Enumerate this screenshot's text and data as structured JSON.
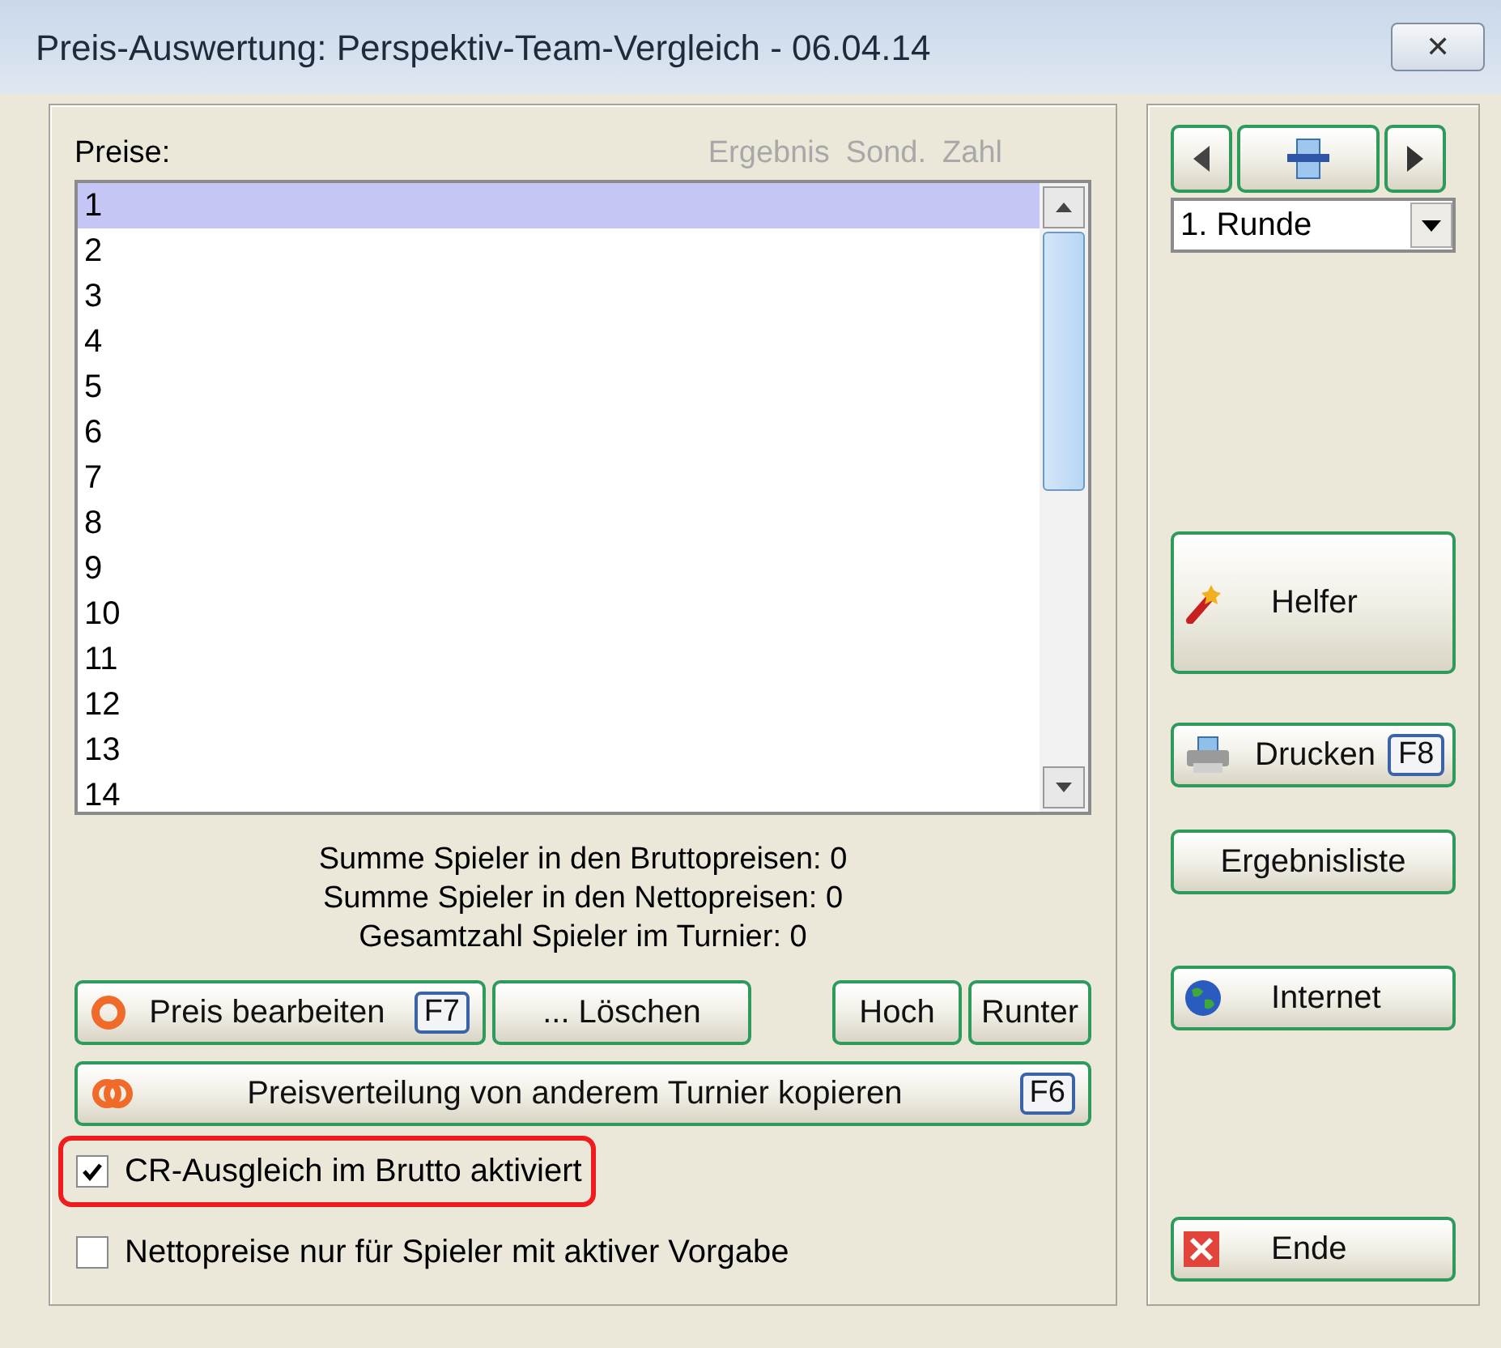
{
  "window": {
    "title": "Preis-Auswertung: Perspektiv-Team-Vergleich - 06.04.14",
    "close": "✕"
  },
  "prizes": {
    "label": "Preise:",
    "columns": [
      "Ergebnis",
      "Sond.",
      "Zahl"
    ],
    "rows": [
      {
        "label": "1",
        "selected": true
      },
      {
        "label": "2",
        "selected": false
      },
      {
        "label": "3",
        "selected": false
      },
      {
        "label": "4",
        "selected": false
      },
      {
        "label": "5",
        "selected": false
      },
      {
        "label": "6",
        "selected": false
      },
      {
        "label": "7",
        "selected": false
      },
      {
        "label": "8",
        "selected": false
      },
      {
        "label": "9",
        "selected": false
      },
      {
        "label": "10",
        "selected": false
      },
      {
        "label": "11",
        "selected": false
      },
      {
        "label": "12",
        "selected": false
      },
      {
        "label": "13",
        "selected": false
      },
      {
        "label": "14",
        "selected": false
      }
    ]
  },
  "summary": [
    "Summe Spieler in den Bruttopreisen: 0",
    "Summe Spieler in den Nettopreisen: 0",
    "Gesamtzahl Spieler im Turnier: 0"
  ],
  "actions": [
    {
      "kind": "edit",
      "label": "Preis bearbeiten",
      "key": "F7"
    },
    {
      "kind": "plain",
      "label": "... Löschen"
    },
    {
      "kind": "plain",
      "label": "Hoch"
    },
    {
      "kind": "plain",
      "label": "Runter"
    }
  ],
  "copy_button": {
    "label": "Preisverteilung von anderem Turnier kopieren",
    "key": "F6"
  },
  "options": [
    {
      "label": "CR-Ausgleich im Brutto aktiviert",
      "checked": true,
      "highlighted": true
    },
    {
      "label": "Nettopreise nur für Spieler mit aktiver Vorgabe",
      "checked": false,
      "highlighted": false
    }
  ],
  "round_select": {
    "value": "1. Runde"
  },
  "side_buttons": [
    {
      "kind": "wand",
      "label": "Helfer"
    },
    {
      "kind": "printer",
      "label": "Drucken",
      "key": "F8"
    },
    {
      "kind": "plain",
      "label": "Ergebnisliste"
    },
    {
      "kind": "globe",
      "label": "Internet"
    },
    {
      "kind": "cross",
      "label": "Ende"
    }
  ]
}
